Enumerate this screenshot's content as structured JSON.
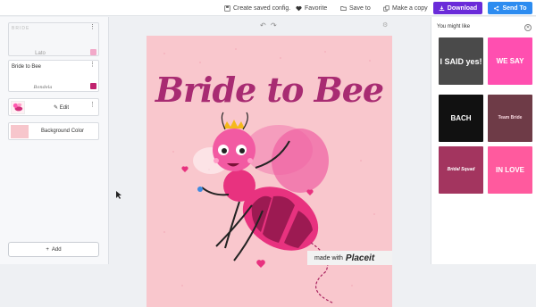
{
  "toolbar": {
    "create_saved_config": "Create saved config.",
    "favorite": "Favorite",
    "save_to": "Save to",
    "make_copy": "Make a copy",
    "download": "Download",
    "send_to": "Send To"
  },
  "left_panel": {
    "text_layer_1": {
      "placeholder": "BRIDE",
      "font": "Lato",
      "color": "#f2a9c9"
    },
    "text_layer_2": {
      "value": "Bride to Bee",
      "font": "Bondela",
      "color": "#c0226e"
    },
    "graphic_layer": {
      "edit_label": "Edit"
    },
    "background_layer": {
      "label": "Background Color",
      "color": "#f7c6cc"
    },
    "add_label": "Add"
  },
  "canvas": {
    "title_text": "Bride to Bee",
    "background_color": "#f9c7cd",
    "watermark_prefix": "made with",
    "watermark_brand": "Placeit"
  },
  "suggestions": {
    "heading": "You might like",
    "items": [
      {
        "text": "I SAID yes!",
        "bg": "#4a4a4a",
        "fg": "#ffffff"
      },
      {
        "text": "WE SAY",
        "bg": "#ff4fb0",
        "fg": "#ffffff"
      },
      {
        "text": "BACH",
        "bg": "#111111",
        "fg": "#ffffff"
      },
      {
        "text": "Team Bride",
        "bg": "#6e3b47",
        "fg": "#f6d6de"
      },
      {
        "text": "Bridal Squad",
        "bg": "#a3355f",
        "fg": "#ffffff"
      },
      {
        "text": "IN LOVE",
        "bg": "#ff5a9e",
        "fg": "#ffffff"
      }
    ]
  }
}
